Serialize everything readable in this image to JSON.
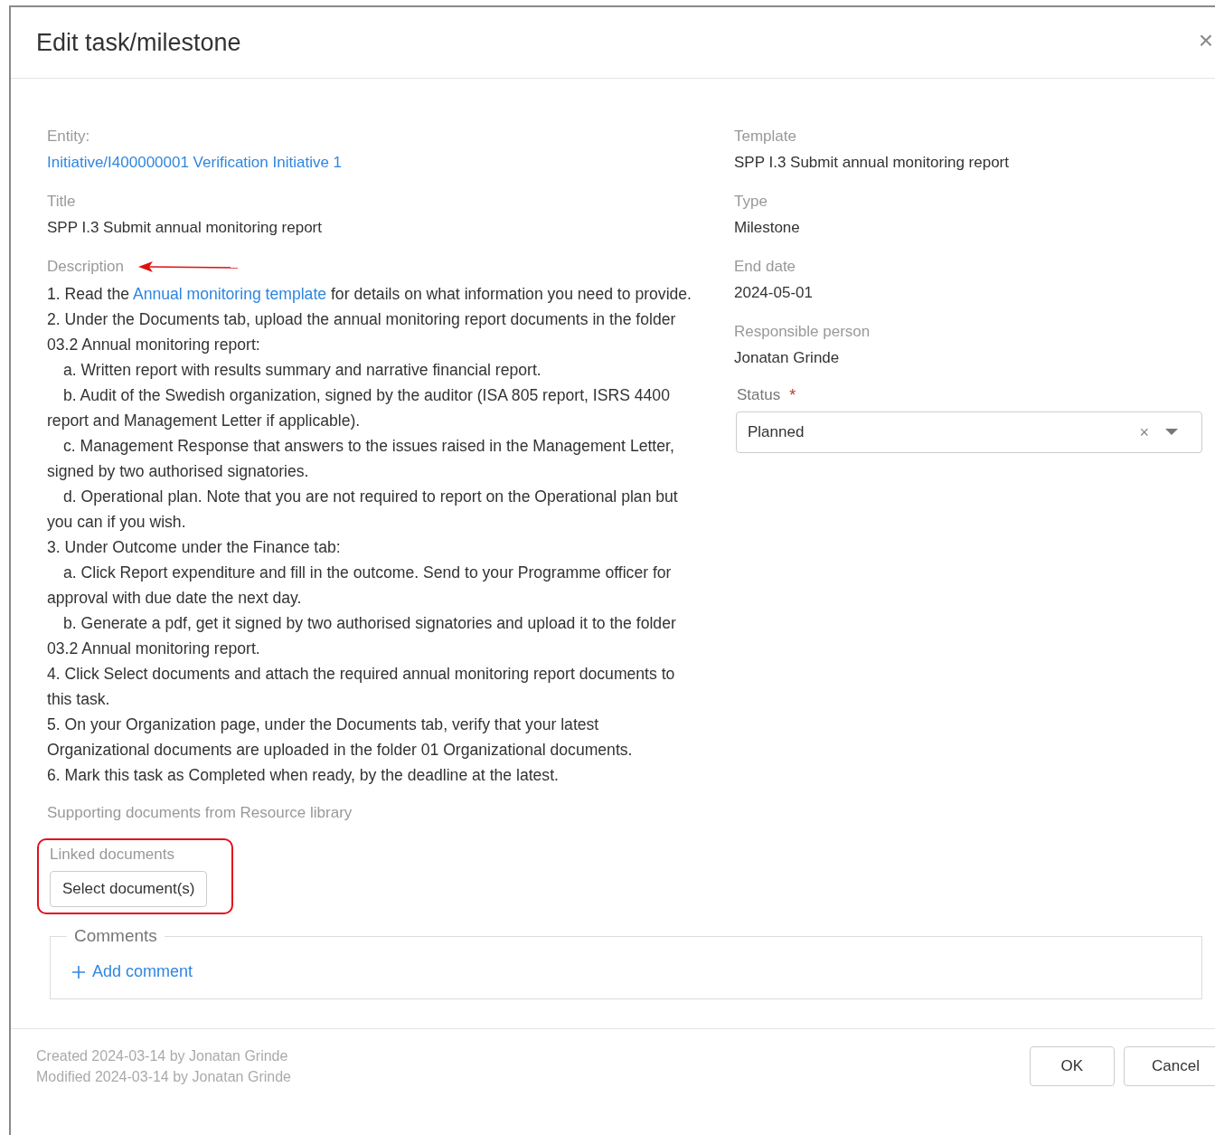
{
  "dialog": {
    "title": "Edit task/milestone",
    "close": "×"
  },
  "left": {
    "entity": {
      "label": "Entity:",
      "value": "Initiative/I400000001 Verification Initiative 1"
    },
    "title": {
      "label": "Title",
      "value": "SPP I.3 Submit annual monitoring report"
    },
    "description": {
      "label": "Description",
      "annotated": true,
      "items": [
        {
          "kind": "step",
          "before": "1. Read the ",
          "link": "Annual monitoring template",
          "after": " for details on what information you need to provide."
        },
        {
          "kind": "step",
          "before": "2. Under the Documents tab, upload the annual monitoring report documents in the folder 03.2 Annual monitoring report:"
        },
        {
          "kind": "sub",
          "before": "a.  Written report with results summary and narrative financial report."
        },
        {
          "kind": "sub",
          "before": "b. Audit of the Swedish organization, signed by the auditor (ISA 805 report, ISRS 4400 report and Management Letter if applicable)."
        },
        {
          "kind": "sub",
          "before": "c.  Management Response that answers to the issues raised in the Management Letter, signed by two authorised signatories."
        },
        {
          "kind": "sub",
          "before": "d. Operational plan. Note that you are not required to report on the Operational plan but you can if you wish."
        },
        {
          "kind": "step",
          "before": "3. Under Outcome under the Finance tab:"
        },
        {
          "kind": "sub",
          "before": "a.  Click Report expenditure and fill in the outcome. Send to your Programme officer for approval with due date the next day."
        },
        {
          "kind": "sub",
          "before": "b. Generate a pdf, get it signed by two authorised signatories and upload it to the folder 03.2 Annual monitoring report."
        },
        {
          "kind": "step",
          "before": "4. Click Select documents and attach the required annual monitoring report documents to this task."
        },
        {
          "kind": "step",
          "before": "5. On your Organization page, under the Documents tab, verify that your latest Organizational documents are uploaded in the folder 01 Organizational documents."
        },
        {
          "kind": "step",
          "before": "6. Mark this task as Completed when ready, by the deadline at the latest."
        }
      ]
    },
    "supporting": {
      "label": "Supporting documents from Resource library"
    },
    "linked": {
      "label": "Linked documents",
      "button": "Select document(s)",
      "highlighted": true
    }
  },
  "right": {
    "fields": [
      {
        "label": "Template",
        "value": "SPP I.3 Submit annual monitoring report"
      },
      {
        "label": "Type",
        "value": "Milestone"
      },
      {
        "label": "End date",
        "value": "2024-05-01"
      },
      {
        "label": "Responsible person",
        "value": "Jonatan Grinde"
      }
    ],
    "status": {
      "label": "Status",
      "required_mark": "*",
      "value": "Planned",
      "clear": "×"
    }
  },
  "comments": {
    "legend": "Comments",
    "add": "Add comment"
  },
  "footer": {
    "created": "Created 2024-03-14 by Jonatan Grinde",
    "modified": "Modified 2024-03-14 by Jonatan Grinde",
    "buttons": [
      "OK",
      "Cancel"
    ]
  }
}
